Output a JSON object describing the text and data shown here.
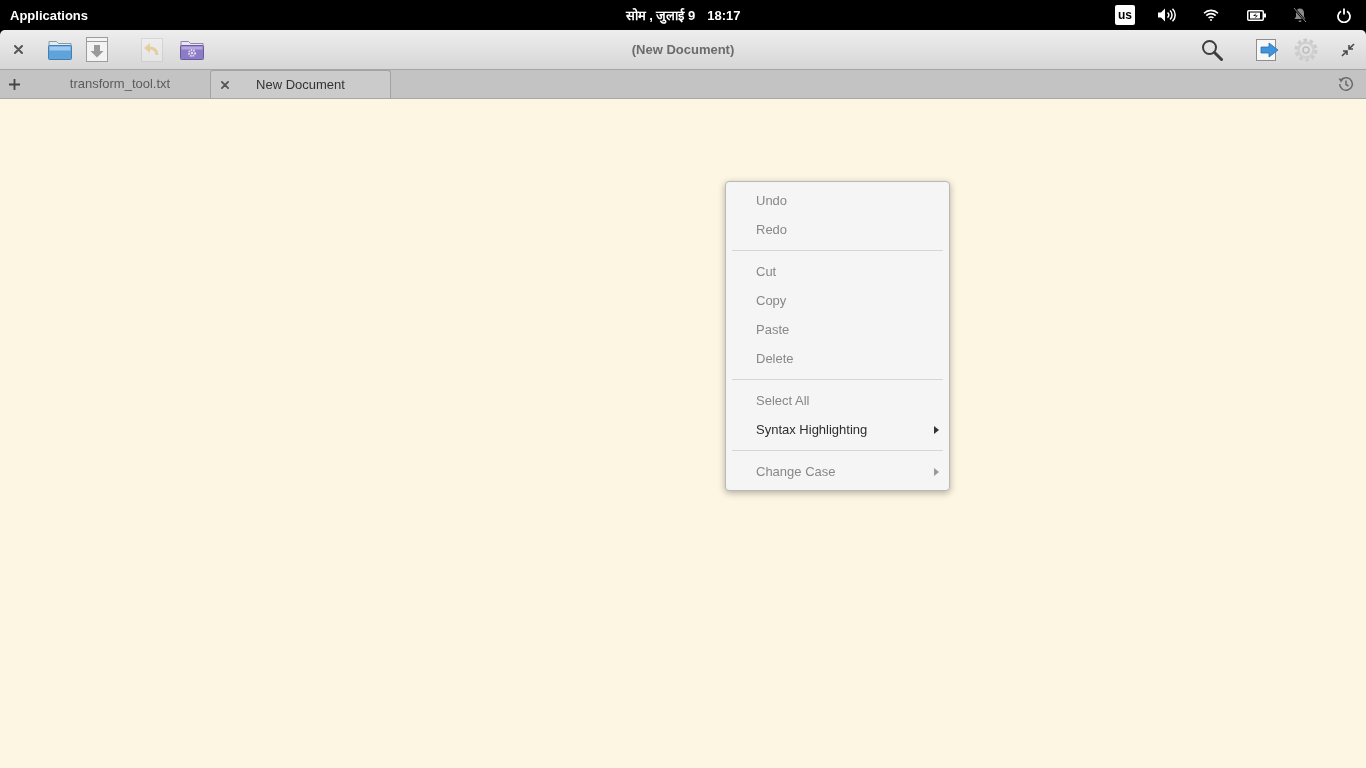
{
  "top_panel": {
    "menu": "Applications",
    "date": "सोम , जुलाई 9",
    "time": "18:17",
    "keyboard_layout": "us"
  },
  "toolbar": {
    "left_buttons": [
      {
        "kind": "close",
        "disabled": false
      },
      {
        "kind": "open",
        "disabled": false
      },
      {
        "kind": "save",
        "disabled": false
      },
      {
        "kind": "revert",
        "disabled": true
      },
      {
        "kind": "project",
        "disabled": false
      }
    ],
    "title": "(New Document)",
    "right_buttons": [
      {
        "kind": "search",
        "disabled": false
      },
      {
        "kind": "share",
        "disabled": false
      },
      {
        "kind": "menu",
        "disabled": false
      },
      {
        "kind": "unfullscreen",
        "disabled": false
      }
    ]
  },
  "tab_bar": {
    "tabs": [
      {
        "label": "transform_tool.txt",
        "selected": false
      },
      {
        "label": "New Document",
        "selected": true
      }
    ]
  },
  "context_menu": {
    "sections": [
      {
        "items": [
          {
            "label": "Undo",
            "disabled": true,
            "submenu": false
          },
          {
            "label": "Redo",
            "disabled": true,
            "submenu": false
          }
        ]
      },
      {
        "items": [
          {
            "label": "Cut",
            "disabled": true,
            "submenu": false
          },
          {
            "label": "Copy",
            "disabled": true,
            "submenu": false
          },
          {
            "label": "Paste",
            "disabled": true,
            "submenu": false
          },
          {
            "label": "Delete",
            "disabled": true,
            "submenu": false
          }
        ]
      },
      {
        "items": [
          {
            "label": "Select All",
            "disabled": true,
            "submenu": false
          },
          {
            "label": "Syntax Highlighting",
            "disabled": false,
            "submenu": true
          }
        ]
      },
      {
        "items": [
          {
            "label": "Change Case",
            "disabled": true,
            "submenu": true
          }
        ]
      }
    ]
  }
}
